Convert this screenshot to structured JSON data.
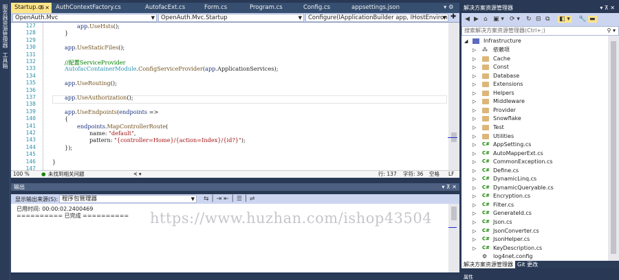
{
  "left_toolstrip": {
    "items": [
      "服务器资源管理器",
      "工具箱"
    ]
  },
  "tabs": [
    {
      "label": "Startup.cs",
      "active": true,
      "pinned": true
    },
    {
      "label": "AuthContextFactory.cs",
      "active": false
    },
    {
      "label": "AutofacExt.cs",
      "active": false
    },
    {
      "label": "Form.cs",
      "active": false
    },
    {
      "label": "Program.cs",
      "active": false
    },
    {
      "label": "Config.cs",
      "active": false
    },
    {
      "label": "appsettings.json",
      "active": false
    }
  ],
  "navbar": {
    "project": "OpenAuth.Mvc",
    "class": "OpenAuth.Mvc.Startup",
    "member": "Configure(IApplicationBuilder app, IHostEnvironment env)"
  },
  "editor": {
    "lines": [
      {
        "num": "127",
        "indent": 2,
        "parts": [
          {
            "t": "app",
            "c": "prm"
          },
          {
            "t": ".",
            "c": ""
          },
          {
            "t": "UseHsts",
            "c": "mt"
          },
          {
            "t": "();",
            "c": ""
          }
        ]
      },
      {
        "num": "128",
        "indent": 1,
        "parts": [
          {
            "t": "}",
            "c": ""
          }
        ]
      },
      {
        "num": "129",
        "indent": 0,
        "parts": []
      },
      {
        "num": "130",
        "indent": 1,
        "parts": [
          {
            "t": "app",
            "c": "prm"
          },
          {
            "t": ".",
            "c": ""
          },
          {
            "t": "UseStaticFiles",
            "c": "mt"
          },
          {
            "t": "();",
            "c": ""
          }
        ]
      },
      {
        "num": "131",
        "indent": 0,
        "parts": []
      },
      {
        "num": "132",
        "indent": 1,
        "parts": [
          {
            "t": "//配置ServiceProvider",
            "c": "cm"
          }
        ]
      },
      {
        "num": "133",
        "indent": 1,
        "parts": [
          {
            "t": "AutofacContainerModule",
            "c": "ty"
          },
          {
            "t": ".",
            "c": ""
          },
          {
            "t": "ConfigServiceProvider",
            "c": "mt"
          },
          {
            "t": "(",
            "c": ""
          },
          {
            "t": "app",
            "c": "prm"
          },
          {
            "t": ".ApplicationServices);",
            "c": ""
          }
        ]
      },
      {
        "num": "134",
        "indent": 0,
        "parts": []
      },
      {
        "num": "135",
        "indent": 1,
        "parts": [
          {
            "t": "app",
            "c": "prm"
          },
          {
            "t": ".",
            "c": ""
          },
          {
            "t": "UseRouting",
            "c": "mt"
          },
          {
            "t": "();",
            "c": ""
          }
        ]
      },
      {
        "num": "136",
        "indent": 0,
        "parts": []
      },
      {
        "num": "137",
        "indent": 1,
        "parts": [
          {
            "t": "app",
            "c": "prm"
          },
          {
            "t": ".",
            "c": ""
          },
          {
            "t": "UseAuthorization",
            "c": "mt"
          },
          {
            "t": "();",
            "c": ""
          }
        ]
      },
      {
        "num": "138",
        "indent": 0,
        "parts": []
      },
      {
        "num": "139",
        "indent": 1,
        "parts": [
          {
            "t": "app",
            "c": "prm"
          },
          {
            "t": ".",
            "c": ""
          },
          {
            "t": "UseEndpoints",
            "c": "mt"
          },
          {
            "t": "(",
            "c": ""
          },
          {
            "t": "endpoints",
            "c": "prm"
          },
          {
            "t": " =>",
            "c": ""
          }
        ]
      },
      {
        "num": "140",
        "indent": 1,
        "parts": [
          {
            "t": "{",
            "c": ""
          }
        ]
      },
      {
        "num": "141",
        "indent": 2,
        "parts": [
          {
            "t": "endpoints",
            "c": "prm"
          },
          {
            "t": ".",
            "c": ""
          },
          {
            "t": "MapControllerRoute",
            "c": "mt"
          },
          {
            "t": "(",
            "c": ""
          }
        ]
      },
      {
        "num": "142",
        "indent": 3,
        "parts": [
          {
            "t": "name: ",
            "c": ""
          },
          {
            "t": "\"default\"",
            "c": "st"
          },
          {
            "t": ",",
            "c": ""
          }
        ]
      },
      {
        "num": "143",
        "indent": 3,
        "parts": [
          {
            "t": "pattern: ",
            "c": ""
          },
          {
            "t": "\"{controller=Home}/{action=Index}/{id?}\"",
            "c": "st"
          },
          {
            "t": ");",
            "c": ""
          }
        ]
      },
      {
        "num": "144",
        "indent": 1,
        "parts": [
          {
            "t": "});",
            "c": ""
          }
        ]
      },
      {
        "num": "145",
        "indent": 0,
        "parts": []
      },
      {
        "num": "146",
        "indent": 0,
        "parts": [
          {
            "t": "}",
            "c": ""
          }
        ]
      },
      {
        "num": "147",
        "indent": 0,
        "parts": []
      }
    ]
  },
  "editor_status": {
    "zoom": "100 %",
    "issues": "未找到相关问题",
    "line": "行: 137",
    "char": "字符: 36",
    "mode": "空格",
    "eol": "LF"
  },
  "output": {
    "title": "输出",
    "source_label": "显示输出来源(S):",
    "source_value": "程序包管理器",
    "lines": [
      "已用时间: 00:00:02.2400469",
      "========== 已完成 =========="
    ]
  },
  "solution": {
    "title": "解决方案资源管理器",
    "search_placeholder": "搜索解决方案资源管理器(Ctrl+;)",
    "root": "Infrastructure",
    "items": [
      {
        "label": "依赖项",
        "kind": "deps"
      },
      {
        "label": "Cache",
        "kind": "folder"
      },
      {
        "label": "Const",
        "kind": "folder"
      },
      {
        "label": "Database",
        "kind": "folder"
      },
      {
        "label": "Extensions",
        "kind": "folder"
      },
      {
        "label": "Helpers",
        "kind": "folder"
      },
      {
        "label": "Middleware",
        "kind": "folder"
      },
      {
        "label": "Provider",
        "kind": "folder"
      },
      {
        "label": "Snowflake",
        "kind": "folder"
      },
      {
        "label": "Test",
        "kind": "folder"
      },
      {
        "label": "Utilities",
        "kind": "folder"
      },
      {
        "label": "AppSetting.cs",
        "kind": "cs"
      },
      {
        "label": "AutoMapperExt.cs",
        "kind": "cs"
      },
      {
        "label": "CommonException.cs",
        "kind": "cs"
      },
      {
        "label": "Define.cs",
        "kind": "cs"
      },
      {
        "label": "DynamicLinq.cs",
        "kind": "cs"
      },
      {
        "label": "DynamicQueryable.cs",
        "kind": "cs"
      },
      {
        "label": "Encryption.cs",
        "kind": "cs"
      },
      {
        "label": "Filter.cs",
        "kind": "cs"
      },
      {
        "label": "GenerateId.cs",
        "kind": "cs"
      },
      {
        "label": "Json.cs",
        "kind": "cs"
      },
      {
        "label": "JsonConverter.cs",
        "kind": "cs"
      },
      {
        "label": "JsonHelper.cs",
        "kind": "cs"
      },
      {
        "label": "KeyDescription.cs",
        "kind": "cs"
      },
      {
        "label": "log4net.config",
        "kind": "config"
      }
    ],
    "bottom_tabs": [
      "解决方案资源管理器",
      "Git 更改"
    ]
  },
  "properties": {
    "title": "属性"
  },
  "watermark": "https://www.huzhan.com/ishop43504",
  "colors": {
    "active_tab": "#ffe58a",
    "ide_frame": "#293955",
    "folder": "#dcb67a",
    "cs_icon": "#178600"
  }
}
